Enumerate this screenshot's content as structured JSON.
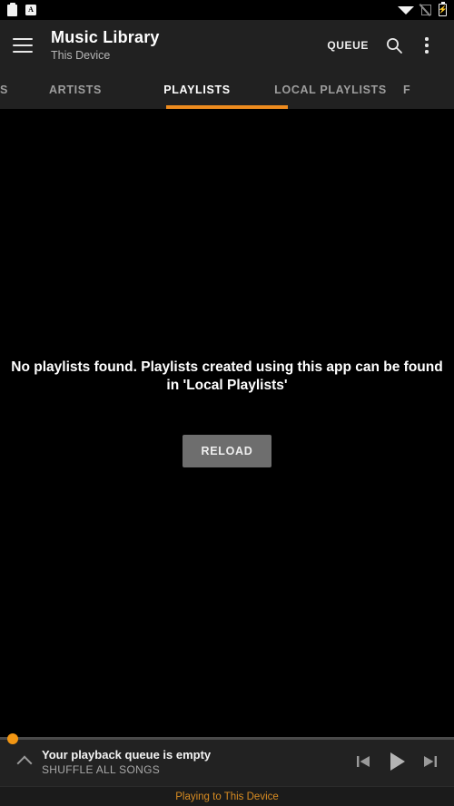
{
  "statusbar": {
    "left_icons": [
      {
        "name": "clipboard-icon",
        "glyph": "clipboard"
      },
      {
        "name": "app-badge-icon",
        "glyph": "A"
      }
    ],
    "right_icons": [
      {
        "name": "wifi-icon",
        "glyph": "wifi"
      },
      {
        "name": "no-signal-icon",
        "glyph": "signal-off"
      },
      {
        "name": "battery-charging-icon",
        "glyph": "⚡"
      }
    ]
  },
  "appbar": {
    "menu_icon": "hamburger-menu-icon",
    "title": "Music Library",
    "subtitle": "This Device",
    "queue_label": "QUEUE",
    "search_icon": "search-icon",
    "overflow_icon": "more-vertical-icon"
  },
  "tabs": {
    "items": [
      {
        "label": "S",
        "active": false,
        "clipped": true
      },
      {
        "label": "ARTISTS",
        "active": false,
        "clipped": false
      },
      {
        "label": "PLAYLISTS",
        "active": true,
        "clipped": false
      },
      {
        "label": "LOCAL PLAYLISTS",
        "active": false,
        "clipped": false
      },
      {
        "label": "F",
        "active": false,
        "clipped": true
      }
    ],
    "active_index": 2,
    "indicator_color": "#ee8b1e"
  },
  "content": {
    "empty_message": "No playlists found. Playlists created using this app can be found in 'Local Playlists'",
    "reload_label": "RELOAD"
  },
  "player": {
    "expand_icon": "chevron-up-icon",
    "line1": "Your playback queue is empty",
    "line2": "SHUFFLE ALL SONGS",
    "seek_progress_percent": 0,
    "seek_thumb_color": "#f29613",
    "controls": [
      {
        "name": "previous-track-button",
        "glyph": "previous"
      },
      {
        "name": "play-button",
        "glyph": "play"
      },
      {
        "name": "next-track-button",
        "glyph": "next"
      }
    ]
  },
  "footer": {
    "text": "Playing to This Device",
    "color": "#d88c22"
  }
}
